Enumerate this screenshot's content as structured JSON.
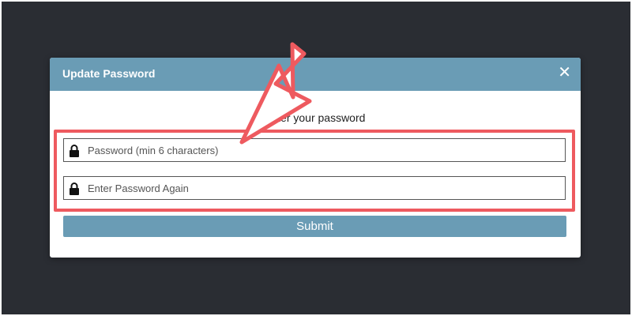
{
  "modal": {
    "title": "Update Password",
    "close_icon": "close-icon",
    "close_glyph": "✕",
    "instruction": "enter your password",
    "fields": [
      {
        "placeholder": "Password (min 6 characters)",
        "value": "",
        "icon": "lock-icon"
      },
      {
        "placeholder": "Enter Password Again",
        "value": "",
        "icon": "lock-icon"
      }
    ],
    "submit_label": "Submit"
  },
  "annotation": {
    "arrow_color": "#ee5a5f",
    "box_color": "#ee5a5f"
  },
  "colors": {
    "backdrop": "#2a2d33",
    "header": "#6a9cb5",
    "submit": "#6a9cb5"
  }
}
